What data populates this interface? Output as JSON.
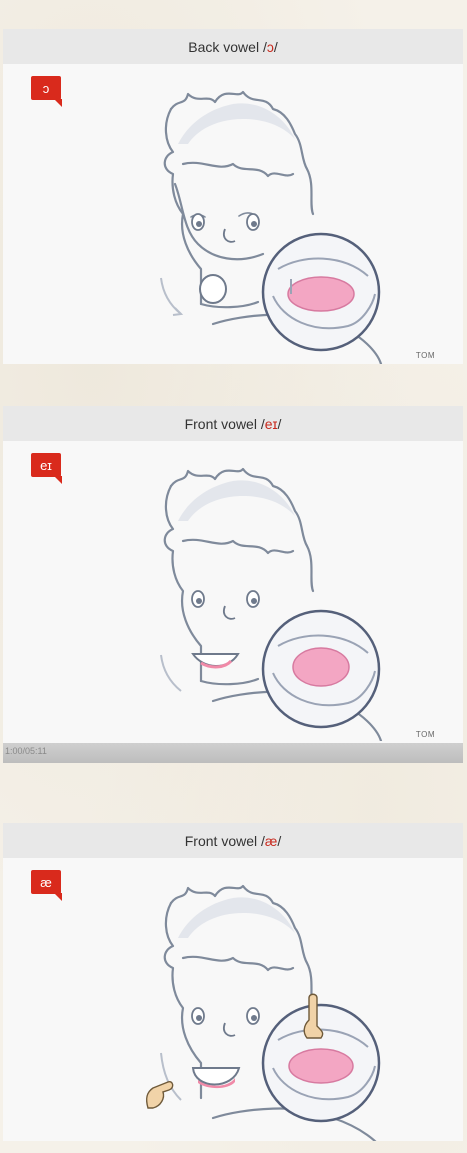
{
  "cards": [
    {
      "title_prefix": "Back vowel",
      "symbol": "ɔ",
      "badge": "ɔ",
      "corner_label": "TOM"
    },
    {
      "title_prefix": "Front vowel",
      "symbol": "eɪ",
      "badge": "eɪ",
      "corner_label": "TOM"
    },
    {
      "title_prefix": "Front vowel",
      "symbol": "æ",
      "badge": "æ"
    }
  ],
  "timestamp": "1:00/05:11",
  "colors": {
    "accent": "#d92a1c",
    "symbol": "#c8291d",
    "tongue": "#f3a6c3"
  },
  "icons": [
    "pointing-hand-icon"
  ]
}
